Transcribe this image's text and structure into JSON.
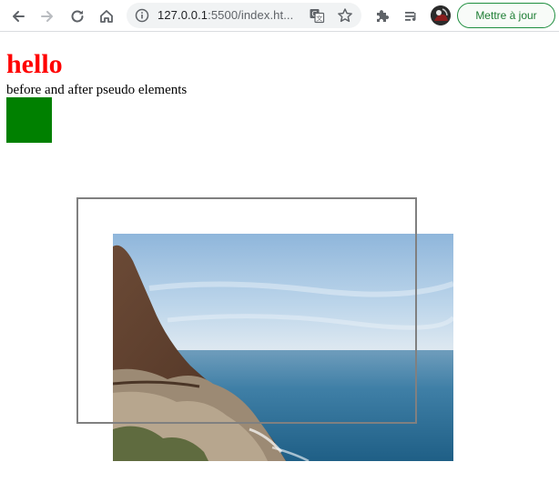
{
  "browser": {
    "url_host": "127.0.0.1",
    "url_rest": ":5500/index.ht...",
    "update_label": "Mettre à jour",
    "icons": {
      "back": "arrow-left-icon",
      "forward": "arrow-right-icon",
      "reload": "reload-icon",
      "home": "home-icon",
      "site_info": "info-icon",
      "translate": "translate-icon",
      "bookmark": "star-icon",
      "extensions": "puzzle-icon",
      "reading_list": "media-queue-icon"
    }
  },
  "page": {
    "heading": "hello",
    "heading_color": "#ff0000",
    "paragraph": "before and after pseudo elements",
    "box_color": "#008000",
    "frame_color": "#808080",
    "image": "coastal cliff and ocean photo"
  }
}
